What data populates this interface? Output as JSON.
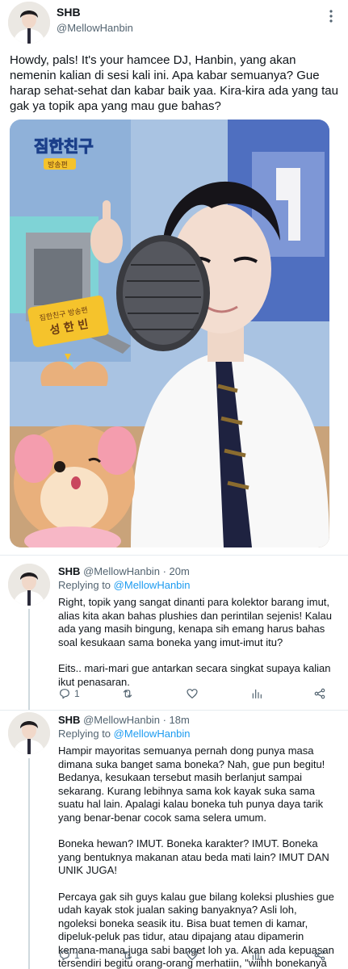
{
  "main_tweet": {
    "display_name": "SHB",
    "handle": "@MellowHanbin",
    "text": "Howdy, pals! It's your hamcee DJ, Hanbin, yang akan nemenin kalian di sesi kali ini. Apa kabar semuanya? Gue harap sehat-sehat dan kabar baik yaa. Kira-kira ada yang tau gak ya topik apa yang mau gue bahas?",
    "image": {
      "logo_text": "짐한친구",
      "logo_sub": "방송편",
      "mic_sign_line1": "짐한친구 방송편",
      "mic_sign_line2": "성 한 빈"
    }
  },
  "replies": [
    {
      "display_name": "SHB",
      "handle": "@MellowHanbin",
      "separator": "·",
      "time": "20m",
      "replying_label": "Replying to",
      "replying_handle": "@MellowHanbin",
      "paragraphs": [
        "Right, topik yang sangat dinanti para kolektor barang imut, alias kita akan bahas plushies dan perintilan sejenis! Kalau ada yang masih bingung, kenapa sih emang harus bahas soal kesukaan sama boneka yang imut-imut itu?",
        "Eits.. mari-mari gue antarkan secara singkat supaya kalian ikut penasaran."
      ],
      "reply_count": "1"
    },
    {
      "display_name": "SHB",
      "handle": "@MellowHanbin",
      "separator": "·",
      "time": "18m",
      "replying_label": "Replying to",
      "replying_handle": "@MellowHanbin",
      "paragraphs": [
        "Hampir mayoritas semuanya pernah dong punya masa dimana suka banget sama boneka? Nah, gue pun begitu! Bedanya, kesukaan tersebut masih berlanjut sampai sekarang. Kurang lebihnya sama kok kayak suka sama suatu hal lain. Apalagi kalau boneka tuh punya daya tarik yang benar-benar cocok sama selera umum.",
        "Boneka hewan? IMUT. Boneka karakter? IMUT. Boneka yang bentuknya makanan atau beda mati lain? IMUT DAN UNIK JUGA!",
        "Percaya gak sih guys kalau gue bilang koleksi plushies gue udah kayak stok jualan saking banyaknya? Asli loh, ngoleksi boneka seasik itu. Bisa buat temen di kamar, dipeluk-peluk pas tidur, atau dipajang atau dipamerin kemana-mana juga sabi banget loh ya. Akan ada kepuasan tersendiri begitu orang-orang merhatiin, \"wiihh bonekanya lucu-lucu ya.\""
      ],
      "reply_count": "1"
    }
  ],
  "icons": {
    "more": "more-icon",
    "reply": "reply-icon",
    "retweet": "retweet-icon",
    "like": "like-icon",
    "analytics": "analytics-icon",
    "share": "share-icon"
  },
  "colors": {
    "text": "#0f1419",
    "secondary": "#536471",
    "link": "#1d9bf0",
    "divider": "#e6ecf0"
  }
}
